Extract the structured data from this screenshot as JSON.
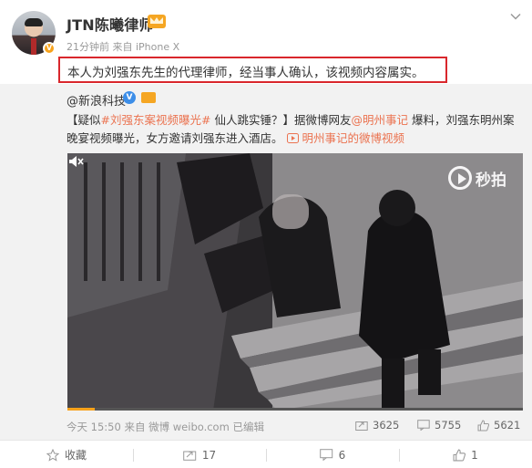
{
  "author": {
    "name": "JTN陈曦律师",
    "meta": "21分钟前 来自 iPhone X",
    "text": "本人为刘强东先生的代理律师，经当事人确认，该视频内容属实。"
  },
  "repost": {
    "author": "@新浪科技",
    "text_part1": "【疑似",
    "hashtag": "#刘强东案视频曝光#",
    "text_part2": " 仙人跳实锤？】据微博网友",
    "mention": "@明州事记",
    "text_part3": " 爆料，刘强东明州案晚宴视频曝光，女方邀请刘强东进入酒店。",
    "video_link": "明州事记的微博视频",
    "video_logo": "秒拍",
    "video_progress": 0.06,
    "time": "今天 15:50 来自 微博 weibo.com 已编辑",
    "reposts": "3625",
    "comments": "5755",
    "likes": "5621"
  },
  "actions": {
    "favorite": "收藏",
    "repost": "17",
    "comment": "6",
    "like": "1"
  },
  "colors": {
    "highlight_border": "#d9272c",
    "link": "#eb7350",
    "accent": "#f7a21b"
  }
}
